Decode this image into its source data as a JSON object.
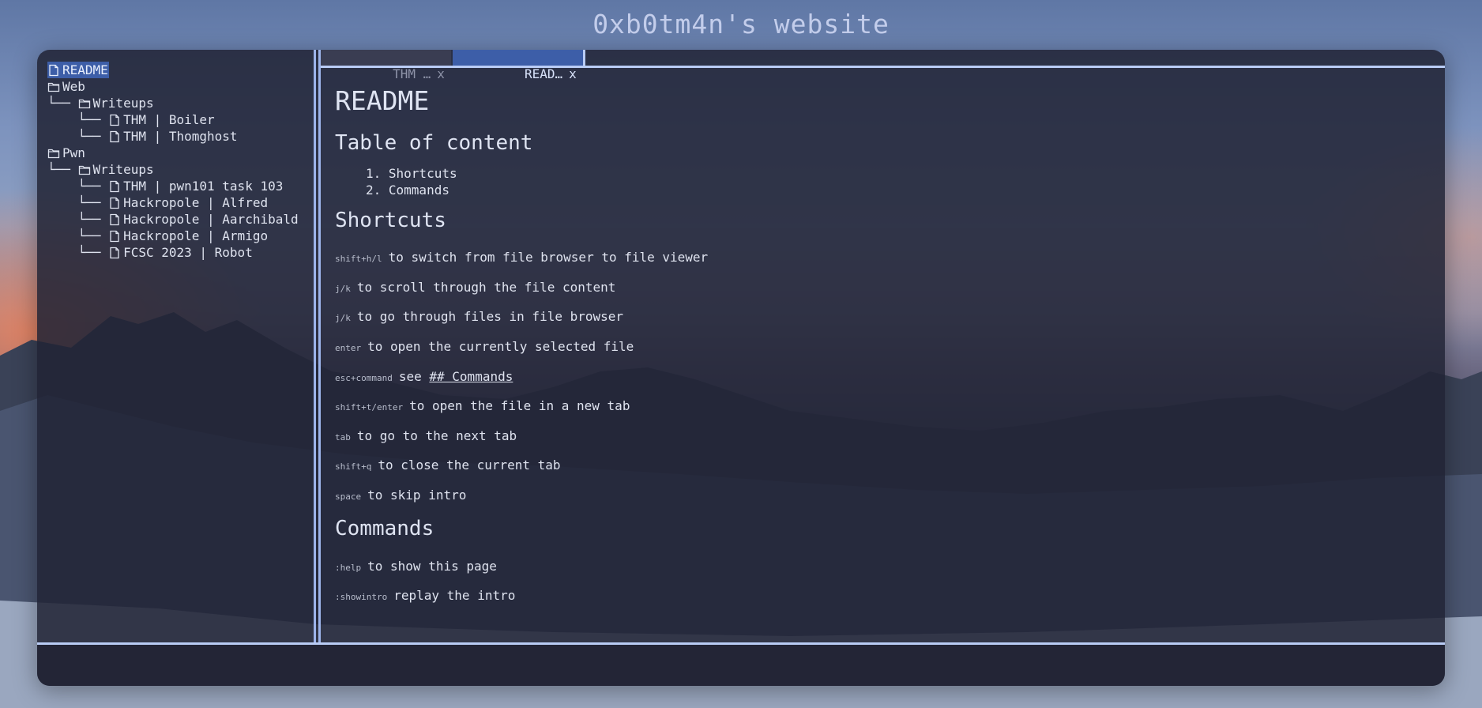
{
  "site": {
    "title": "0xb0tm4n's website"
  },
  "sidebar": {
    "tree": [
      {
        "prefix": "",
        "type": "file",
        "label": "README",
        "selected": true
      },
      {
        "prefix": "",
        "type": "folder",
        "label": "Web"
      },
      {
        "prefix": "└── ",
        "type": "folder",
        "label": "Writeups"
      },
      {
        "prefix": "    └── ",
        "type": "file",
        "label": "THM | Boiler"
      },
      {
        "prefix": "    └── ",
        "type": "file",
        "label": "THM | Thomghost"
      },
      {
        "prefix": "",
        "type": "folder",
        "label": "Pwn"
      },
      {
        "prefix": "└── ",
        "type": "folder",
        "label": "Writeups"
      },
      {
        "prefix": "    └── ",
        "type": "file",
        "label": "THM | pwn101 task 103"
      },
      {
        "prefix": "    └── ",
        "type": "file",
        "label": "Hackropole | Alfred"
      },
      {
        "prefix": "    └── ",
        "type": "file",
        "label": "Hackropole | Aarchibald"
      },
      {
        "prefix": "    └── ",
        "type": "file",
        "label": "Hackropole | Armigo"
      },
      {
        "prefix": "    └── ",
        "type": "file",
        "label": "FCSC 2023 | Robot"
      }
    ]
  },
  "tabs": [
    {
      "label": "THM …",
      "close": "x",
      "active": false
    },
    {
      "label": "READ…",
      "close": "x",
      "active": true
    }
  ],
  "content": {
    "title": "README",
    "toc_heading": "Table of content",
    "toc": [
      "1. Shortcuts",
      "2. Commands"
    ],
    "shortcuts_heading": "Shortcuts",
    "shortcuts": [
      {
        "key": "shift+h/l",
        "text": "to switch from file browser to file viewer"
      },
      {
        "key": "j/k",
        "text": "to scroll through the file content"
      },
      {
        "key": "j/k",
        "text": "to go through files in file browser"
      },
      {
        "key": "enter",
        "text": "to open the currently selected file"
      },
      {
        "key": "esc+command",
        "text": "see ",
        "link": "## Commands"
      },
      {
        "key": "shift+t/enter",
        "text": "to open the file in a new tab"
      },
      {
        "key": "tab",
        "text": "to go to the next tab"
      },
      {
        "key": "shift+q",
        "text": "to close the current tab"
      },
      {
        "key": "space",
        "text": "to skip intro"
      }
    ],
    "commands_heading": "Commands",
    "commands": [
      {
        "key": ":help",
        "text": "to show this page"
      },
      {
        "key": ":showintro",
        "text": "replay the intro"
      }
    ]
  },
  "colors": {
    "accent": "#9db4ea",
    "selection": "#3d5ea8",
    "window_bg": "#212334",
    "text": "#dfe3ef"
  }
}
